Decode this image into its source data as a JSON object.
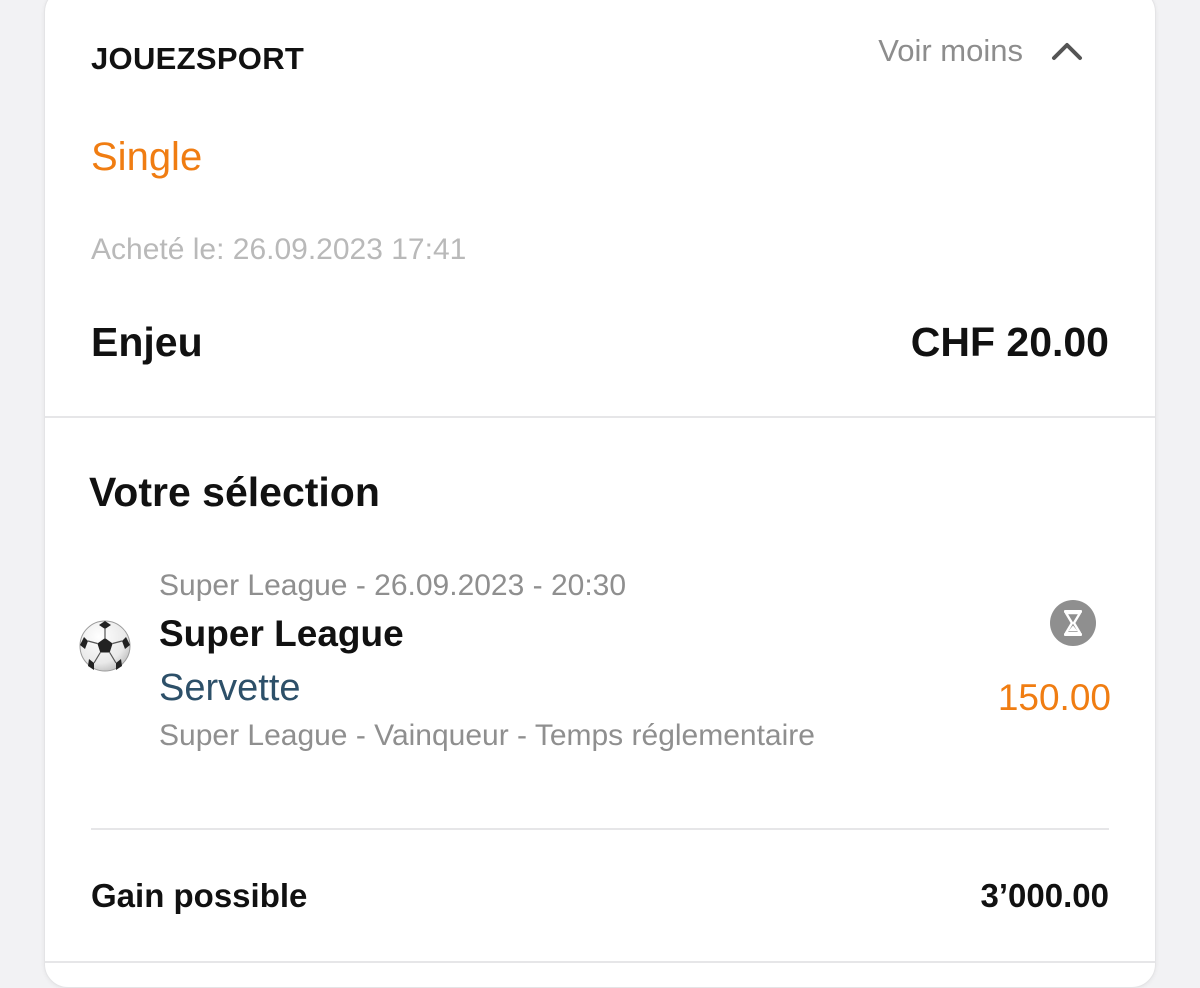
{
  "header": {
    "brand": "JOUEZSPORT",
    "toggle_label": "Voir moins",
    "toggle_icon": "chevron-up-icon"
  },
  "bet": {
    "type": "Single",
    "purchased": "Acheté le: 26.09.2023 17:41",
    "stake_label": "Enjeu",
    "stake_value": "CHF 20.00"
  },
  "selection": {
    "title": "Votre sélection",
    "sport_icon": "soccer-ball-icon",
    "event_meta": "Super League - 26.09.2023 - 20:30",
    "event_name": "Super League",
    "pick": "Servette",
    "market": "Super League - Vainqueur - Temps réglementaire",
    "status_icon": "hourglass-icon",
    "odds": "150.00"
  },
  "summary": {
    "gain_label": "Gain possible",
    "gain_value": "3’000.00"
  },
  "colors": {
    "accent": "#f07d12",
    "pick": "#2d5069",
    "muted": "#8f8f8f",
    "faint": "#b9b9b9"
  }
}
